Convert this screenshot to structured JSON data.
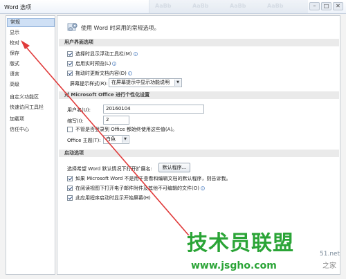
{
  "window": {
    "title": "Word 选项",
    "minimize": "–",
    "maximize": "□",
    "close": "✕"
  },
  "ghost_ribbon": [
    "AaBb",
    "AaBb",
    "AaBb",
    "AaBb"
  ],
  "sidebar": {
    "items": [
      {
        "label": "常规",
        "active": true
      },
      {
        "label": "显示"
      },
      {
        "label": "校对"
      },
      {
        "label": "保存"
      },
      {
        "label": "版式"
      },
      {
        "label": "语言"
      },
      {
        "label": "高级"
      },
      {
        "label": "自定义功能区"
      },
      {
        "label": "快速访问工具栏"
      },
      {
        "label": "加载项"
      },
      {
        "label": "信任中心"
      }
    ]
  },
  "header": {
    "text": "使用 Word 时采用的常规选项。",
    "icon": "settings-icon"
  },
  "ui_options": {
    "section": "用户界面选项",
    "mini_toolbar": {
      "label": "选择时显示浮动工具栏(M)",
      "checked": true
    },
    "live_preview": {
      "label": "启用实时预览(L)",
      "checked": true
    },
    "update_content": {
      "label": "拖动时更新文档内容(D)",
      "checked": true
    },
    "screentip_label": "屏幕提示样式(R):",
    "screentip_value": "在屏幕提示中显示功能说明"
  },
  "personalize": {
    "section": "对 Microsoft Office 进行个性化设置",
    "username_label": "用户名(U):",
    "username_value": "20160104",
    "initials_label": "缩写(I):",
    "initials_value": "2",
    "always_use": {
      "label": "不管是否登录到 Office 都始终使用这些值(A)。",
      "checked": false
    },
    "theme_label": "Office 主题(T):",
    "theme_value": "白色"
  },
  "startup": {
    "section": "启动选项",
    "default_ext_label": "选择希望 Word 默认情况下打开扩展名:",
    "default_programs_button": "默认程序...",
    "tell_me": {
      "label": "如果 Microsoft Word 不是用于查看和编辑文档的默认程序，则告诉我。",
      "checked": true
    },
    "open_attachments": {
      "label": "在阅读视图下打开电子邮件附件及其他不可编辑的文件(O)",
      "checked": true
    },
    "show_start": {
      "label": "此应用程序启动时显示开始屏幕(H)",
      "checked": true
    }
  },
  "watermark": {
    "main": "技术员联盟",
    "url": "www.jsgho.com",
    "side": "51.net",
    "badge": "之家"
  },
  "annotation": {
    "color": "#e03a3a"
  }
}
